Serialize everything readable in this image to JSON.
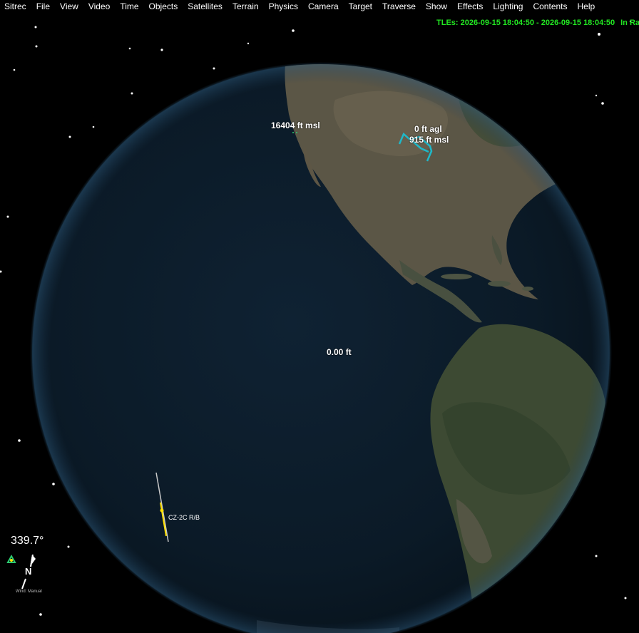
{
  "menu": [
    "Sitrec",
    "File",
    "View",
    "Video",
    "Time",
    "Objects",
    "Satellites",
    "Terrain",
    "Physics",
    "Camera",
    "Target",
    "Traverse",
    "Show",
    "Effects",
    "Lighting",
    "Contents",
    "Help"
  ],
  "tle": {
    "label": "TLEs: 2026-09-15 18:04:50 - 2026-09-15 18:04:50",
    "status": "In Range"
  },
  "labels": {
    "peak_alt": "16404 ft msl",
    "agl": "0 ft agl",
    "msl": "915 ft msl",
    "center": "0.00 ft",
    "satellite": "CZ-2C R/B"
  },
  "hud": {
    "heading": "339.7°",
    "north": "N",
    "wind": "Wind: Manual"
  },
  "colors": {
    "tle_text": "#22e622",
    "track": "#1fb8c8",
    "satellite": "#ffe000"
  }
}
